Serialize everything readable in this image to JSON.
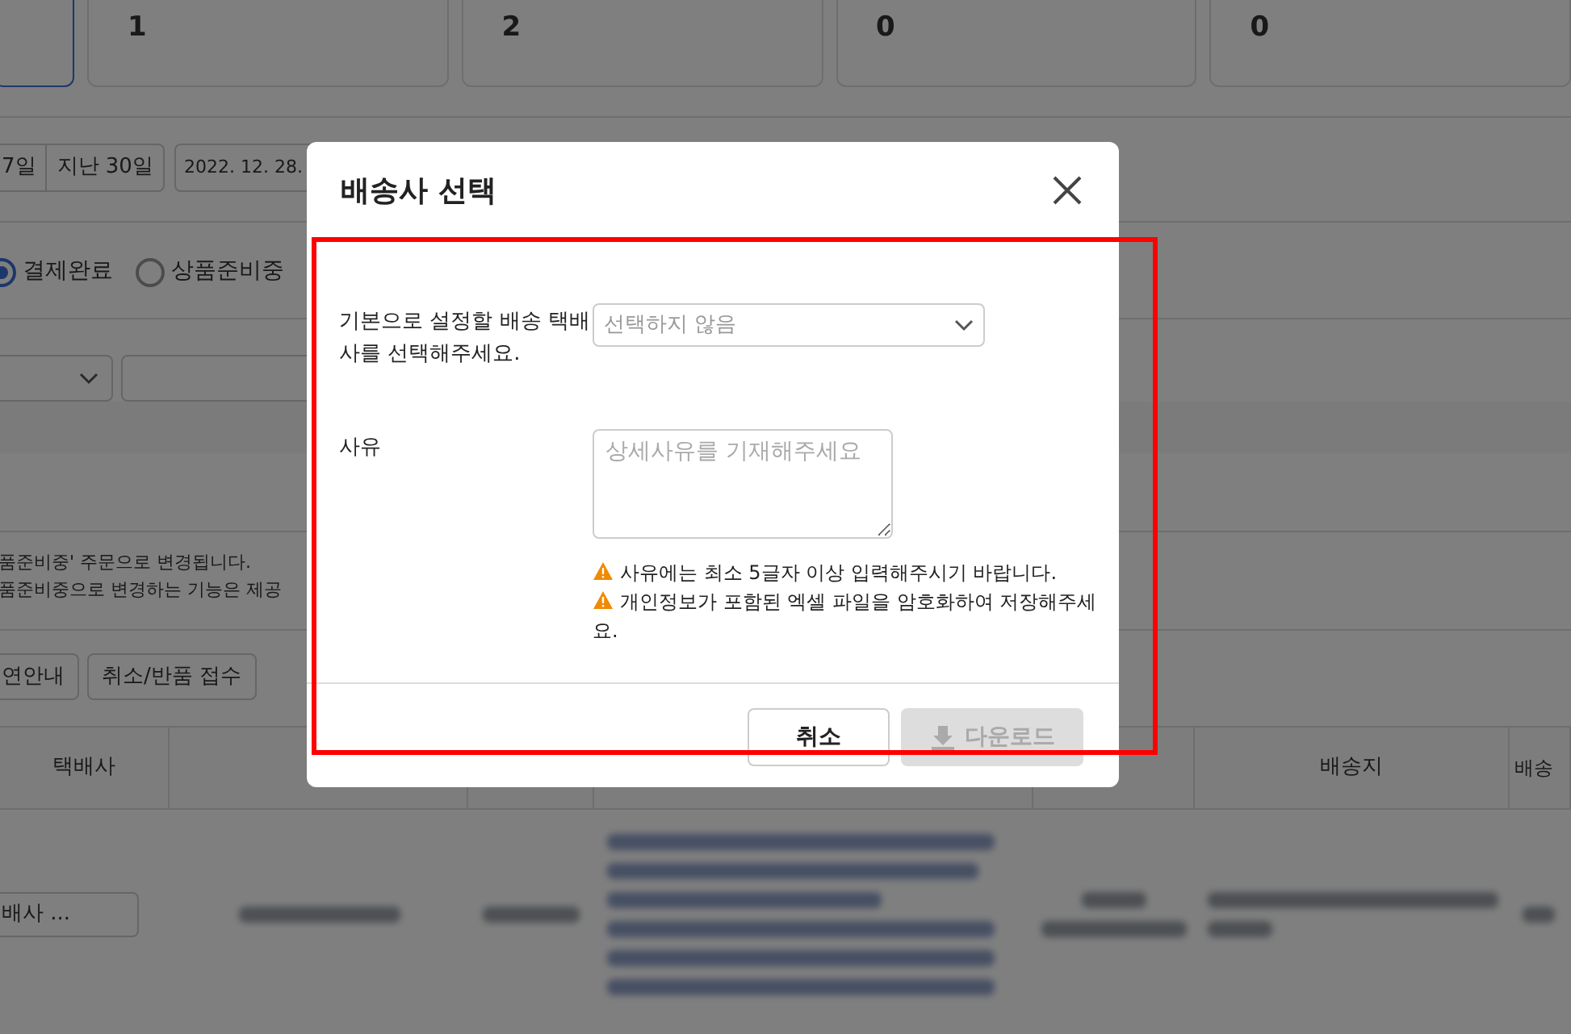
{
  "background": {
    "cards": [
      {
        "selected": true
      },
      {
        "value": "1",
        "selected": false
      },
      {
        "value": "2",
        "selected": false
      },
      {
        "value": "0",
        "selected": false
      },
      {
        "value": "0",
        "selected": false
      }
    ],
    "date_buttons": [
      "7일",
      "지난 30일"
    ],
    "date_field": "2022. 12. 28.",
    "status_radios": [
      {
        "label": "결제완료",
        "selected": true
      },
      {
        "label": "상품준비중",
        "selected": false
      }
    ],
    "notices": [
      "품준비중' 주문으로 변경됩니다.",
      "품준비중으로 변경하는 기능은 제공"
    ],
    "action_buttons": [
      "연안내",
      "취소/반품 접수"
    ],
    "table": {
      "columns": [
        "택배사",
        "",
        "",
        "",
        "",
        "배송지",
        "배송"
      ],
      "rows": [
        {
          "courier_select": "배사 ..."
        }
      ]
    }
  },
  "dialog": {
    "title": "배송사 선택",
    "fields": [
      {
        "kind": "select",
        "label": "기본으로 설정할 배송 택배사를 선택해주세요.",
        "placeholder": "선택하지 않음"
      },
      {
        "kind": "textarea",
        "label": "사유",
        "placeholder": "상세사유를 기재해주세요"
      }
    ],
    "warnings": [
      "사유에는 최소 5글자 이상 입력해주시기 바랍니다.",
      "개인정보가 포함된 엑셀 파일을 암호화하여 저장해주세요."
    ],
    "buttons": [
      {
        "kind": "cancel",
        "label": "취소",
        "disabled": false
      },
      {
        "kind": "download",
        "label": "다운로드",
        "disabled": true
      }
    ]
  }
}
